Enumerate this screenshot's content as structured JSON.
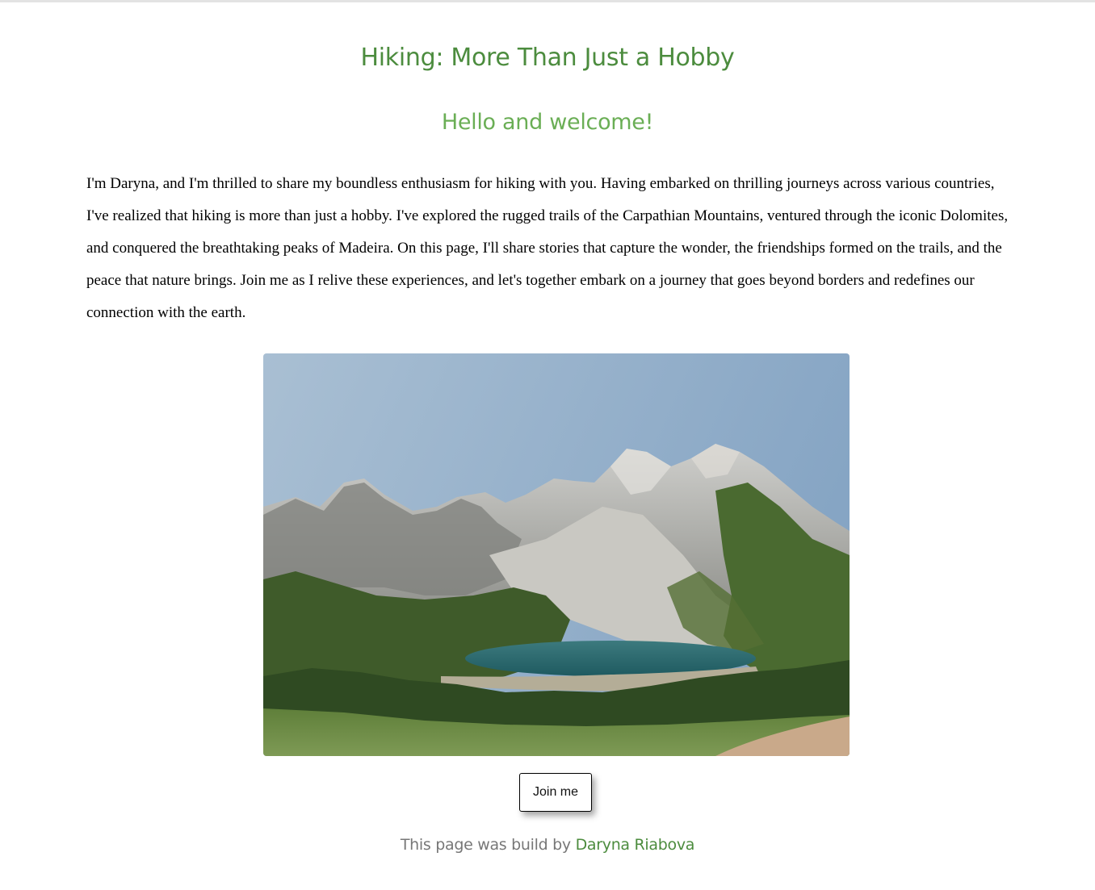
{
  "page": {
    "title": "Hiking: More Than Just a Hobby",
    "subtitle": "Hello and welcome!",
    "intro": "I'm Daryna, and I'm thrilled to share my boundless enthusiasm for hiking with you. Having embarked on thrilling journeys across various countries, I've realized that hiking is more than just a hobby. I've explored the rugged trails of the Carpathian Mountains, ventured through the iconic Dolomites, and conquered the breathtaking peaks of Madeira. On this page, I'll share stories that capture the wonder, the friendships formed on the trails, and the peace that nature brings. Join me as I relive these experiences, and let's together embark on a journey that goes beyond borders and redefines our connection with the earth."
  },
  "image": {
    "icon": "mountain-lake-photo"
  },
  "cta": {
    "label": "Join me"
  },
  "footer": {
    "prefix": "This page was build by",
    "author": "Daryna Riabova"
  },
  "colors": {
    "title": "#4c8c3e",
    "subtitle": "#6aae55",
    "footer_text": "#777777",
    "link": "#4c8c3e"
  }
}
